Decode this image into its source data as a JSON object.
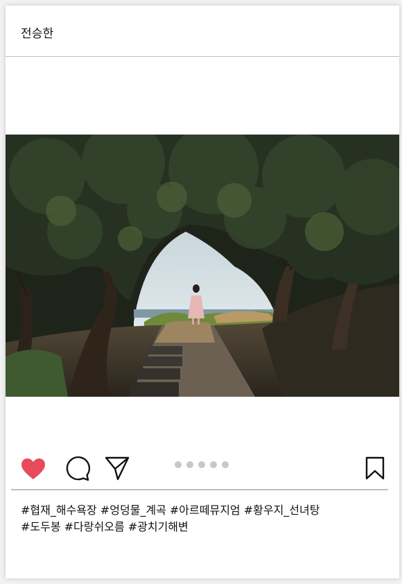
{
  "post": {
    "username": "전승한",
    "photo_alt": "Girl in pink dress under a tunnel of trees on a stone path by the sea",
    "carousel_dots": 5,
    "caption_lines": [
      "#협재_해수욕장 #엉덩물_계곡 #아르떼뮤지엄 #황우지_선녀탕",
      "#도두봉 #다랑쉬오름 #광치기해변"
    ]
  },
  "colors": {
    "like": "#e84b5c",
    "icon_stroke": "#111111",
    "dot": "#c8c8c8",
    "divider": "#bdbdbd"
  },
  "icons": {
    "like": "heart-icon",
    "comment": "comment-icon",
    "share": "paper-plane-icon",
    "save": "bookmark-icon"
  }
}
